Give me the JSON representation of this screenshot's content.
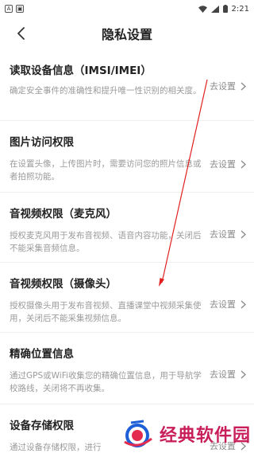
{
  "status_bar": {
    "time": "2:21"
  },
  "header": {
    "title": "隐私设置"
  },
  "items": [
    {
      "title": "读取设备信息（IMSI/IMEI）",
      "desc": "确定安全事件的准确性和提升唯一性识别的相关度。",
      "action": "去设置"
    },
    {
      "title": "图片访问权限",
      "desc": "在设置头像，上传图片时，需要访问您的照片信息或者拍照功能。",
      "action": "去设置"
    },
    {
      "title": "音视频权限（麦克风）",
      "desc": "授权麦克风用于发布音视频、语音内容功能，关闭后不能采集音频信息。",
      "action": "去设置"
    },
    {
      "title": "音视频权限（摄像头）",
      "desc": "授权摄像头用于发布音视频、直播课堂中视频采集使用，关闭后不能采集视频信息。",
      "action": "去设置"
    },
    {
      "title": "精确位置信息",
      "desc": "通过GPS或WiFi收集您的精确位置信息，用于导航学校路线，关闭将不再收集。",
      "action": "去设置"
    },
    {
      "title": "设备存储权限",
      "desc": "通过设备存储权限，进行",
      "action": "去设置"
    }
  ],
  "watermark": {
    "text": "经典软件园"
  },
  "colors": {
    "annotation": "#e02020",
    "watermark": "#c81f5a",
    "logo_blue": "#1e5fd8"
  }
}
